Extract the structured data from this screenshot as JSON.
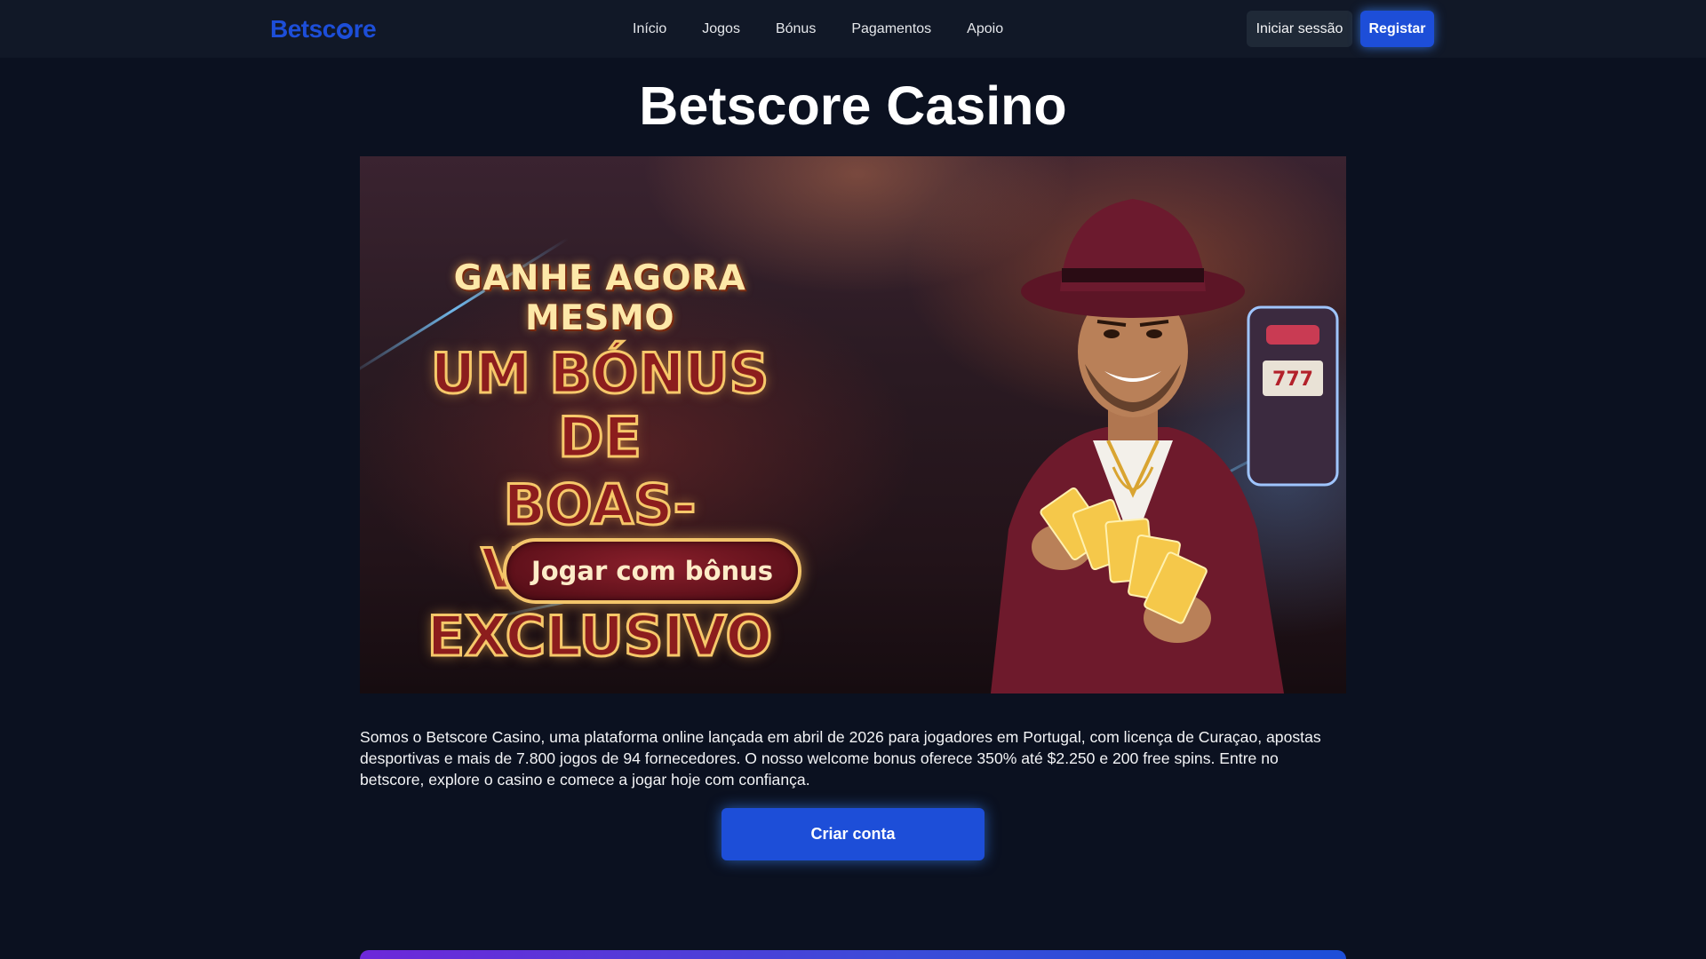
{
  "header": {
    "logo_text_a": "Betsc",
    "logo_text_b": "re",
    "nav": [
      "Início",
      "Jogos",
      "Bónus",
      "Pagamentos",
      "Apoio"
    ],
    "login_label": "Iniciar sessão",
    "register_label": "Registar"
  },
  "main": {
    "title": "Betscore Casino",
    "banner": {
      "line1": "GANHE AGORA MESMO",
      "line2": "UM BÓNUS DE",
      "line3": "BOAS-VINDAS",
      "line4": "EXCLUSIVO",
      "cta_label": "Jogar com bônus"
    },
    "intro": "Somos o Betscore Casino, uma plataforma online lançada em abril de 2026 para jogadores em Portugal, com licença de Curaçao, apostas desportivas e mais de 7.800 jogos de 94 fornecedores. O nosso welcome bonus oferece 350% até $2.250 e 200 free spins. Entre no betscore, explore o casino e comece a jogar hoje com confiança.",
    "create_account_label": "Criar conta"
  },
  "colors": {
    "page_bg": "#0b1120",
    "header_bg": "#111827",
    "accent": "#1d4ed8"
  },
  "icons": {
    "logo": "soccer-ball-o"
  }
}
